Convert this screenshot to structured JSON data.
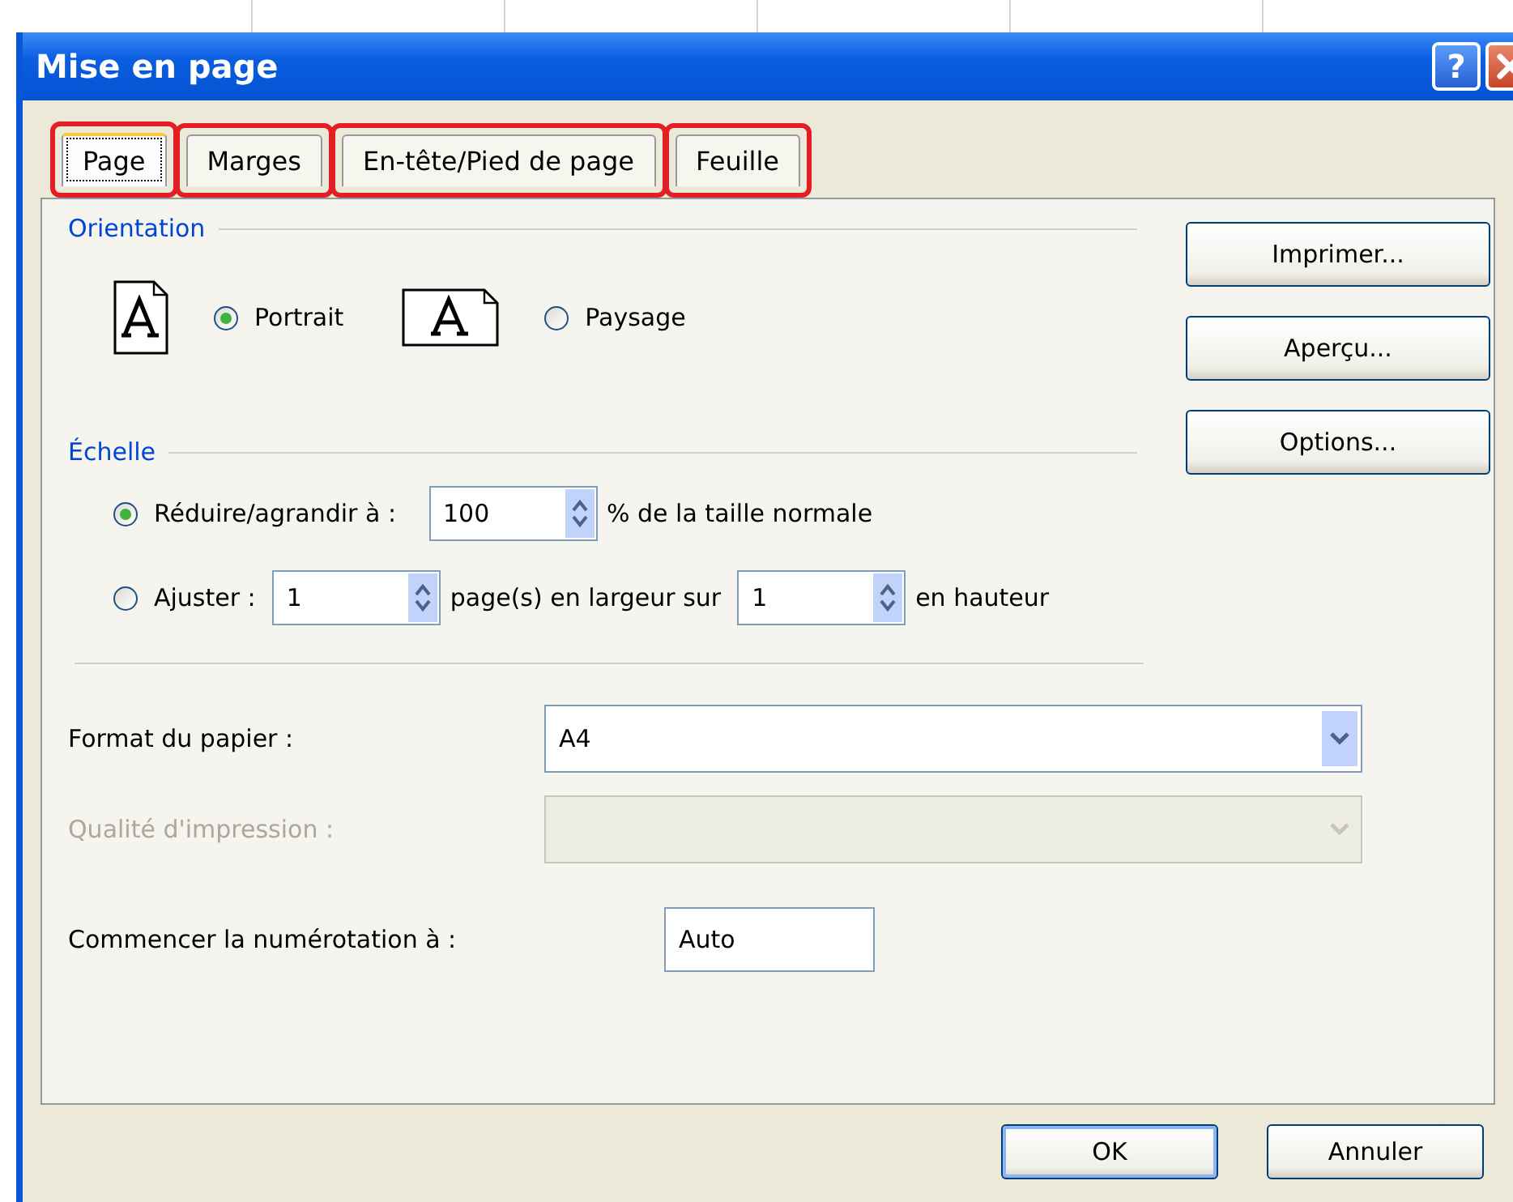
{
  "window": {
    "title": "Mise en page",
    "help_label": "?"
  },
  "tabs": [
    {
      "label": "Page",
      "selected": true,
      "highlighted": true
    },
    {
      "label": "Marges",
      "selected": false,
      "highlighted": true
    },
    {
      "label": "En-tête/Pied de page",
      "selected": false,
      "highlighted": true
    },
    {
      "label": "Feuille",
      "selected": false,
      "highlighted": true
    }
  ],
  "orientation": {
    "heading": "Orientation",
    "options": [
      {
        "kind": "portrait",
        "label": "Portrait",
        "selected": true
      },
      {
        "kind": "landscape",
        "label": "Paysage",
        "selected": false
      }
    ]
  },
  "scale": {
    "heading": "Échelle",
    "options": [
      {
        "kind": "reduce",
        "label": "Réduire/agrandir à :",
        "selected": true,
        "value": "100",
        "suffix": "% de la taille normale"
      },
      {
        "kind": "fit",
        "label": "Ajuster :",
        "selected": false,
        "width_value": "1",
        "width_suffix": "page(s) en largeur sur",
        "height_value": "1",
        "height_suffix": "en hauteur"
      }
    ]
  },
  "side_buttons": [
    "Imprimer...",
    "Aperçu...",
    "Options..."
  ],
  "selects": [
    {
      "label": "Format du papier :",
      "value": "A4",
      "disabled": false
    },
    {
      "label": "Qualité d'impression :",
      "disabled": true
    }
  ],
  "first_page_number": {
    "label": "Commencer la numérotation à :",
    "value": "Auto"
  },
  "footer_buttons": [
    {
      "label": "OK",
      "default": true
    },
    {
      "label": "Annuler",
      "default": false
    }
  ]
}
